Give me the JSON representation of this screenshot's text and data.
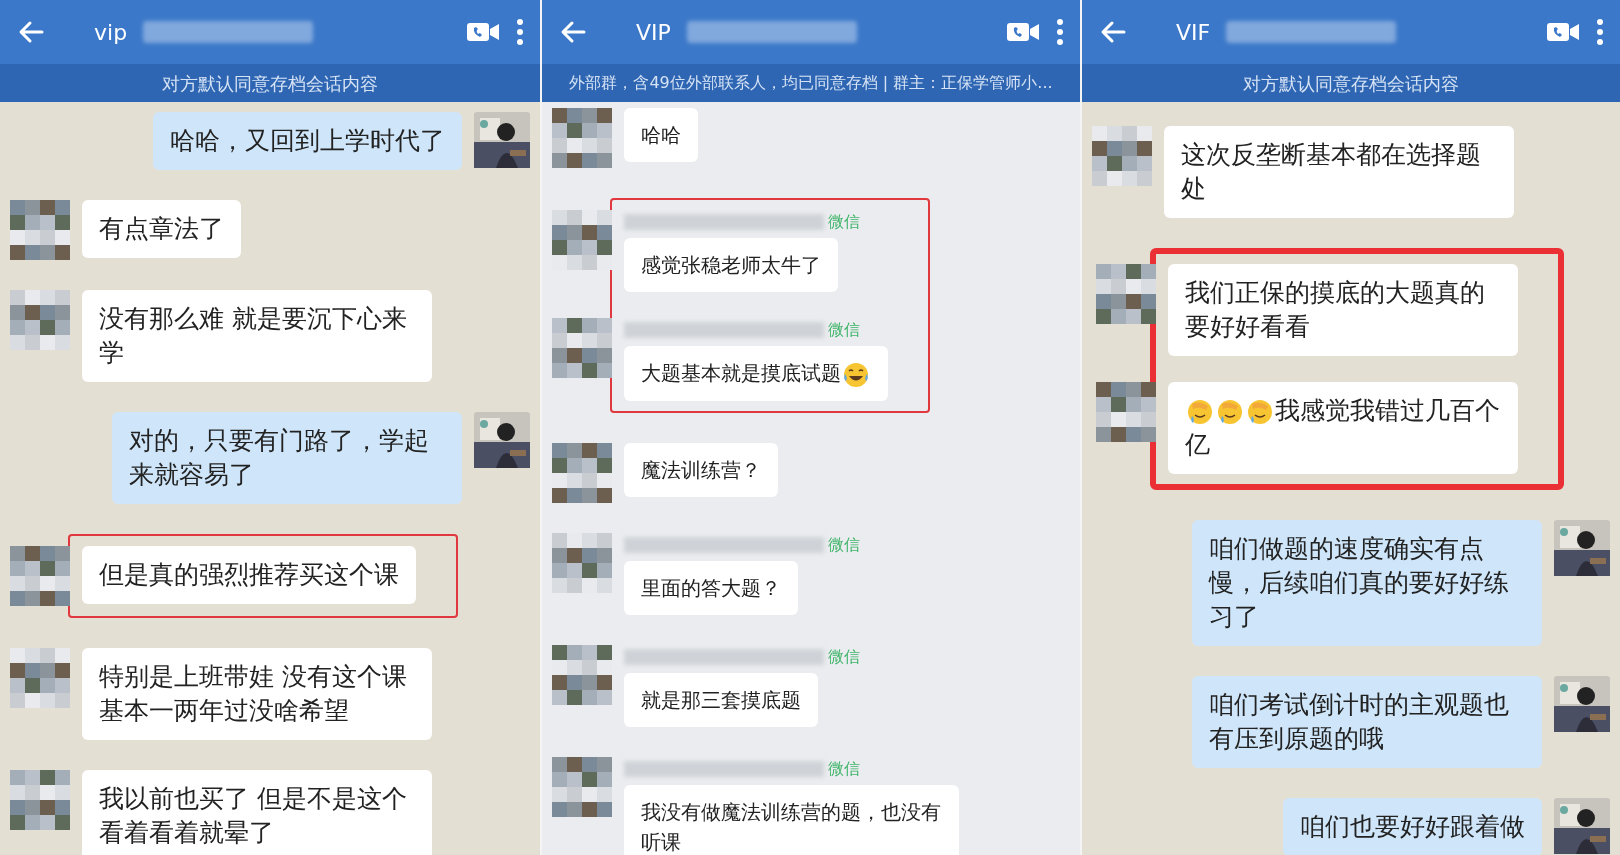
{
  "panels": [
    {
      "kind": "private",
      "title": "vip",
      "subtitle": "对方默认同意存档会话内容",
      "thick_highlight": false,
      "messages": [
        {
          "sent": true,
          "text": "哈哈，又回到上学时代了",
          "highlight": false
        },
        {
          "sent": false,
          "text": "有点章法了",
          "highlight": false
        },
        {
          "sent": false,
          "text": "没有那么难 就是要沉下心来学",
          "highlight": false
        },
        {
          "sent": true,
          "text": "对的，只要有门路了，学起来就容易了",
          "highlight": false
        },
        {
          "sent": false,
          "text": "但是真的强烈推荐买这个课",
          "highlight": true
        },
        {
          "sent": false,
          "text": "特别是上班带娃 没有这个课基本一两年过没啥希望",
          "highlight": false
        },
        {
          "sent": false,
          "text": "我以前也买了 但是不是这个看着看着就晕了",
          "highlight": false
        }
      ]
    },
    {
      "kind": "group",
      "title": "VIP",
      "subtitle": "外部群，含49位外部联系人，均已同意存档 | 群主：正保学管师小...",
      "thick_highlight": false,
      "messages": [
        {
          "sent": false,
          "text": "哈哈",
          "highlight": false
        },
        {
          "sent": false,
          "tag": "微信",
          "text": "感觉张稳老师太牛了",
          "highlight": true
        },
        {
          "sent": false,
          "tag": "微信",
          "text": "大题基本就是摸底试题",
          "emojis_after": [
            {
              "kind": "tears-of-joy"
            }
          ],
          "highlight": true
        },
        {
          "sent": false,
          "text": "魔法训练营？",
          "highlight": false
        },
        {
          "sent": false,
          "tag": "微信",
          "text": "里面的答大题？",
          "highlight": false
        },
        {
          "sent": false,
          "tag": "微信",
          "text": "就是那三套摸底题",
          "highlight": false
        },
        {
          "sent": false,
          "tag": "微信",
          "text": "我没有做魔法训练营的题，也没有听课",
          "highlight": false
        }
      ]
    },
    {
      "kind": "private",
      "title": "VIF",
      "subtitle": "对方默认同意存档会话内容",
      "thick_highlight": true,
      "messages": [
        {
          "sent": false,
          "text": "这次反垄断基本都在选择题处",
          "highlight": false
        },
        {
          "sent": false,
          "text": "我们正保的摸底的大题真的要好好看看",
          "highlight": true
        },
        {
          "sent": false,
          "text": "我感觉我错过几百个亿",
          "emojis_before": [
            {
              "kind": "facepalm"
            },
            {
              "kind": "facepalm"
            },
            {
              "kind": "facepalm"
            }
          ],
          "highlight": true
        },
        {
          "sent": true,
          "text": "咱们做题的速度确实有点慢，后续咱们真的要好好练习了",
          "highlight": false
        },
        {
          "sent": true,
          "text": "咱们考试倒计时的主观题也有压到原题的哦",
          "highlight": false
        },
        {
          "sent": true,
          "text": "咱们也要好好跟着做",
          "highlight": false
        }
      ]
    }
  ]
}
